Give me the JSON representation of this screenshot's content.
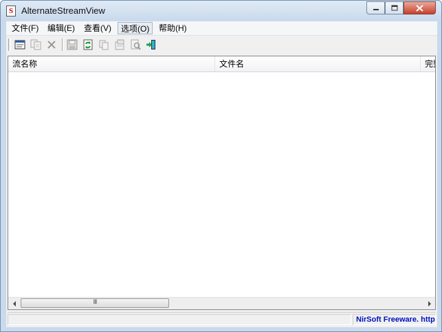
{
  "window": {
    "title": "AlternateStreamView",
    "app_icon_letter": "S",
    "buttons": {
      "minimize_icon": "minimize-icon",
      "maximize_icon": "maximize-icon",
      "close_icon": "close-icon"
    }
  },
  "menubar": {
    "items": [
      {
        "label": "文件(F)"
      },
      {
        "label": "编辑(E)"
      },
      {
        "label": "查看(V)"
      },
      {
        "label": "选项(O)",
        "active": true
      },
      {
        "label": "帮助(H)"
      }
    ]
  },
  "toolbar": {
    "buttons": [
      {
        "icon": "properties-icon",
        "enabled": true
      },
      {
        "icon": "copy-stream-icon",
        "enabled": false
      },
      {
        "icon": "delete-icon",
        "enabled": false
      },
      {
        "icon": "save-icon",
        "enabled": false
      },
      {
        "icon": "refresh-icon",
        "enabled": true
      },
      {
        "icon": "copy-icon",
        "enabled": false
      },
      {
        "icon": "html-report-icon",
        "enabled": false
      },
      {
        "icon": "find-icon",
        "enabled": false
      },
      {
        "icon": "exit-icon",
        "enabled": true
      }
    ]
  },
  "list": {
    "columns": [
      {
        "label": "流名称"
      },
      {
        "label": "文件名"
      },
      {
        "label": "完整"
      }
    ],
    "rows": []
  },
  "statusbar": {
    "left_text": "",
    "right_text": "NirSoft Freeware.  http://www.nirsoft.net"
  },
  "scrollbar": {
    "thumb_grip": "III"
  },
  "colors": {
    "status_link": "#0010c0",
    "close_button": "#c7402b",
    "title_bar": "#c8d9ec"
  }
}
